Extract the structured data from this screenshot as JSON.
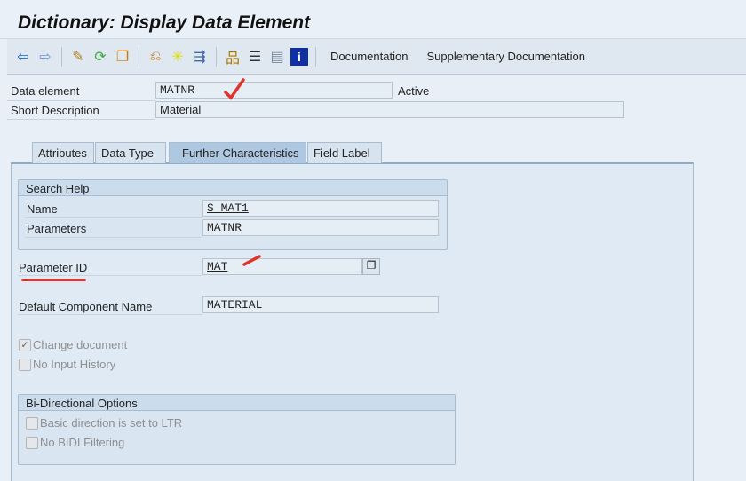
{
  "title": "Dictionary: Display Data Element",
  "toolbar": {
    "documentation": "Documentation",
    "supplementary": "Supplementary Documentation"
  },
  "header": {
    "data_element_label": "Data element",
    "data_element_value": "MATNR",
    "status": "Active",
    "short_desc_label": "Short Description",
    "short_desc_value": "Material"
  },
  "tabs": [
    "Attributes",
    "Data Type",
    "Further Characteristics",
    "Field Label"
  ],
  "search_help": {
    "title": "Search Help",
    "name_label": "Name",
    "name_value": "S_MAT1",
    "params_label": "Parameters",
    "params_value": "MATNR"
  },
  "parameter_id": {
    "label": "Parameter ID",
    "value": "MAT"
  },
  "default_component": {
    "label": "Default Component Name",
    "value": "MATERIAL"
  },
  "checkboxes": [
    {
      "label": "Change document",
      "checked": true
    },
    {
      "label": "No Input History",
      "checked": false
    }
  ],
  "bidi": {
    "title": "Bi-Directional Options",
    "options": [
      {
        "label": "Basic direction is set to LTR",
        "checked": false
      },
      {
        "label": "No BIDI Filtering",
        "checked": false
      }
    ]
  }
}
